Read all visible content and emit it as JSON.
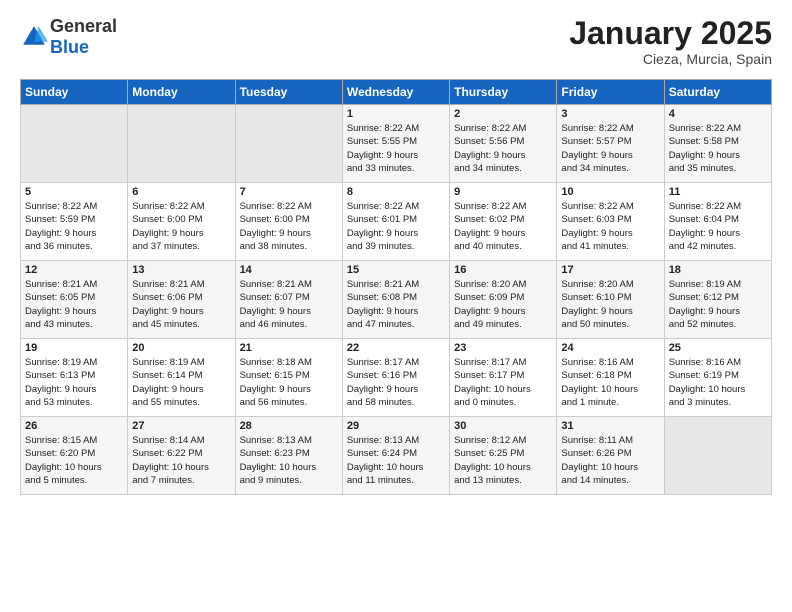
{
  "logo": {
    "general": "General",
    "blue": "Blue"
  },
  "header": {
    "month": "January 2025",
    "location": "Cieza, Murcia, Spain"
  },
  "weekdays": [
    "Sunday",
    "Monday",
    "Tuesday",
    "Wednesday",
    "Thursday",
    "Friday",
    "Saturday"
  ],
  "weeks": [
    [
      {
        "day": "",
        "info": ""
      },
      {
        "day": "",
        "info": ""
      },
      {
        "day": "",
        "info": ""
      },
      {
        "day": "1",
        "info": "Sunrise: 8:22 AM\nSunset: 5:55 PM\nDaylight: 9 hours\nand 33 minutes."
      },
      {
        "day": "2",
        "info": "Sunrise: 8:22 AM\nSunset: 5:56 PM\nDaylight: 9 hours\nand 34 minutes."
      },
      {
        "day": "3",
        "info": "Sunrise: 8:22 AM\nSunset: 5:57 PM\nDaylight: 9 hours\nand 34 minutes."
      },
      {
        "day": "4",
        "info": "Sunrise: 8:22 AM\nSunset: 5:58 PM\nDaylight: 9 hours\nand 35 minutes."
      }
    ],
    [
      {
        "day": "5",
        "info": "Sunrise: 8:22 AM\nSunset: 5:59 PM\nDaylight: 9 hours\nand 36 minutes."
      },
      {
        "day": "6",
        "info": "Sunrise: 8:22 AM\nSunset: 6:00 PM\nDaylight: 9 hours\nand 37 minutes."
      },
      {
        "day": "7",
        "info": "Sunrise: 8:22 AM\nSunset: 6:00 PM\nDaylight: 9 hours\nand 38 minutes."
      },
      {
        "day": "8",
        "info": "Sunrise: 8:22 AM\nSunset: 6:01 PM\nDaylight: 9 hours\nand 39 minutes."
      },
      {
        "day": "9",
        "info": "Sunrise: 8:22 AM\nSunset: 6:02 PM\nDaylight: 9 hours\nand 40 minutes."
      },
      {
        "day": "10",
        "info": "Sunrise: 8:22 AM\nSunset: 6:03 PM\nDaylight: 9 hours\nand 41 minutes."
      },
      {
        "day": "11",
        "info": "Sunrise: 8:22 AM\nSunset: 6:04 PM\nDaylight: 9 hours\nand 42 minutes."
      }
    ],
    [
      {
        "day": "12",
        "info": "Sunrise: 8:21 AM\nSunset: 6:05 PM\nDaylight: 9 hours\nand 43 minutes."
      },
      {
        "day": "13",
        "info": "Sunrise: 8:21 AM\nSunset: 6:06 PM\nDaylight: 9 hours\nand 45 minutes."
      },
      {
        "day": "14",
        "info": "Sunrise: 8:21 AM\nSunset: 6:07 PM\nDaylight: 9 hours\nand 46 minutes."
      },
      {
        "day": "15",
        "info": "Sunrise: 8:21 AM\nSunset: 6:08 PM\nDaylight: 9 hours\nand 47 minutes."
      },
      {
        "day": "16",
        "info": "Sunrise: 8:20 AM\nSunset: 6:09 PM\nDaylight: 9 hours\nand 49 minutes."
      },
      {
        "day": "17",
        "info": "Sunrise: 8:20 AM\nSunset: 6:10 PM\nDaylight: 9 hours\nand 50 minutes."
      },
      {
        "day": "18",
        "info": "Sunrise: 8:19 AM\nSunset: 6:12 PM\nDaylight: 9 hours\nand 52 minutes."
      }
    ],
    [
      {
        "day": "19",
        "info": "Sunrise: 8:19 AM\nSunset: 6:13 PM\nDaylight: 9 hours\nand 53 minutes."
      },
      {
        "day": "20",
        "info": "Sunrise: 8:19 AM\nSunset: 6:14 PM\nDaylight: 9 hours\nand 55 minutes."
      },
      {
        "day": "21",
        "info": "Sunrise: 8:18 AM\nSunset: 6:15 PM\nDaylight: 9 hours\nand 56 minutes."
      },
      {
        "day": "22",
        "info": "Sunrise: 8:17 AM\nSunset: 6:16 PM\nDaylight: 9 hours\nand 58 minutes."
      },
      {
        "day": "23",
        "info": "Sunrise: 8:17 AM\nSunset: 6:17 PM\nDaylight: 10 hours\nand 0 minutes."
      },
      {
        "day": "24",
        "info": "Sunrise: 8:16 AM\nSunset: 6:18 PM\nDaylight: 10 hours\nand 1 minute."
      },
      {
        "day": "25",
        "info": "Sunrise: 8:16 AM\nSunset: 6:19 PM\nDaylight: 10 hours\nand 3 minutes."
      }
    ],
    [
      {
        "day": "26",
        "info": "Sunrise: 8:15 AM\nSunset: 6:20 PM\nDaylight: 10 hours\nand 5 minutes."
      },
      {
        "day": "27",
        "info": "Sunrise: 8:14 AM\nSunset: 6:22 PM\nDaylight: 10 hours\nand 7 minutes."
      },
      {
        "day": "28",
        "info": "Sunrise: 8:13 AM\nSunset: 6:23 PM\nDaylight: 10 hours\nand 9 minutes."
      },
      {
        "day": "29",
        "info": "Sunrise: 8:13 AM\nSunset: 6:24 PM\nDaylight: 10 hours\nand 11 minutes."
      },
      {
        "day": "30",
        "info": "Sunrise: 8:12 AM\nSunset: 6:25 PM\nDaylight: 10 hours\nand 13 minutes."
      },
      {
        "day": "31",
        "info": "Sunrise: 8:11 AM\nSunset: 6:26 PM\nDaylight: 10 hours\nand 14 minutes."
      },
      {
        "day": "",
        "info": ""
      }
    ]
  ]
}
